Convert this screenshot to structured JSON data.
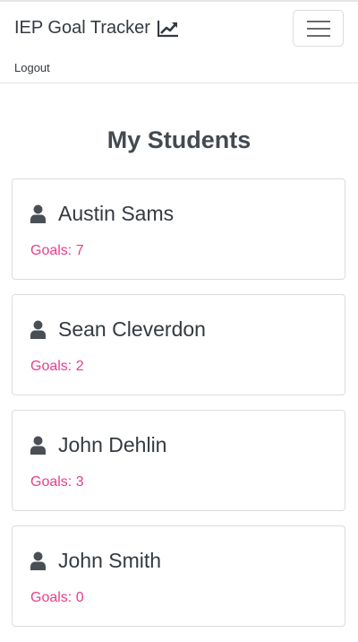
{
  "navbar": {
    "brand": "IEP Goal Tracker",
    "brand_icon": "chart-line-icon",
    "toggler_icon": "hamburger-menu-icon",
    "logout_label": "Logout"
  },
  "page": {
    "title": "My Students"
  },
  "students": [
    {
      "name": "Austin Sams",
      "goals_label": "Goals: 7",
      "icon": "user-icon"
    },
    {
      "name": "Sean Cleverdon",
      "goals_label": "Goals: 2",
      "icon": "user-icon"
    },
    {
      "name": "John Dehlin",
      "goals_label": "Goals: 3",
      "icon": "user-icon"
    },
    {
      "name": "John Smith",
      "goals_label": "Goals: 0",
      "icon": "user-icon"
    }
  ],
  "colors": {
    "goals_text": "#e83e8c",
    "text": "#343a40",
    "border": "#dcdcdc"
  }
}
